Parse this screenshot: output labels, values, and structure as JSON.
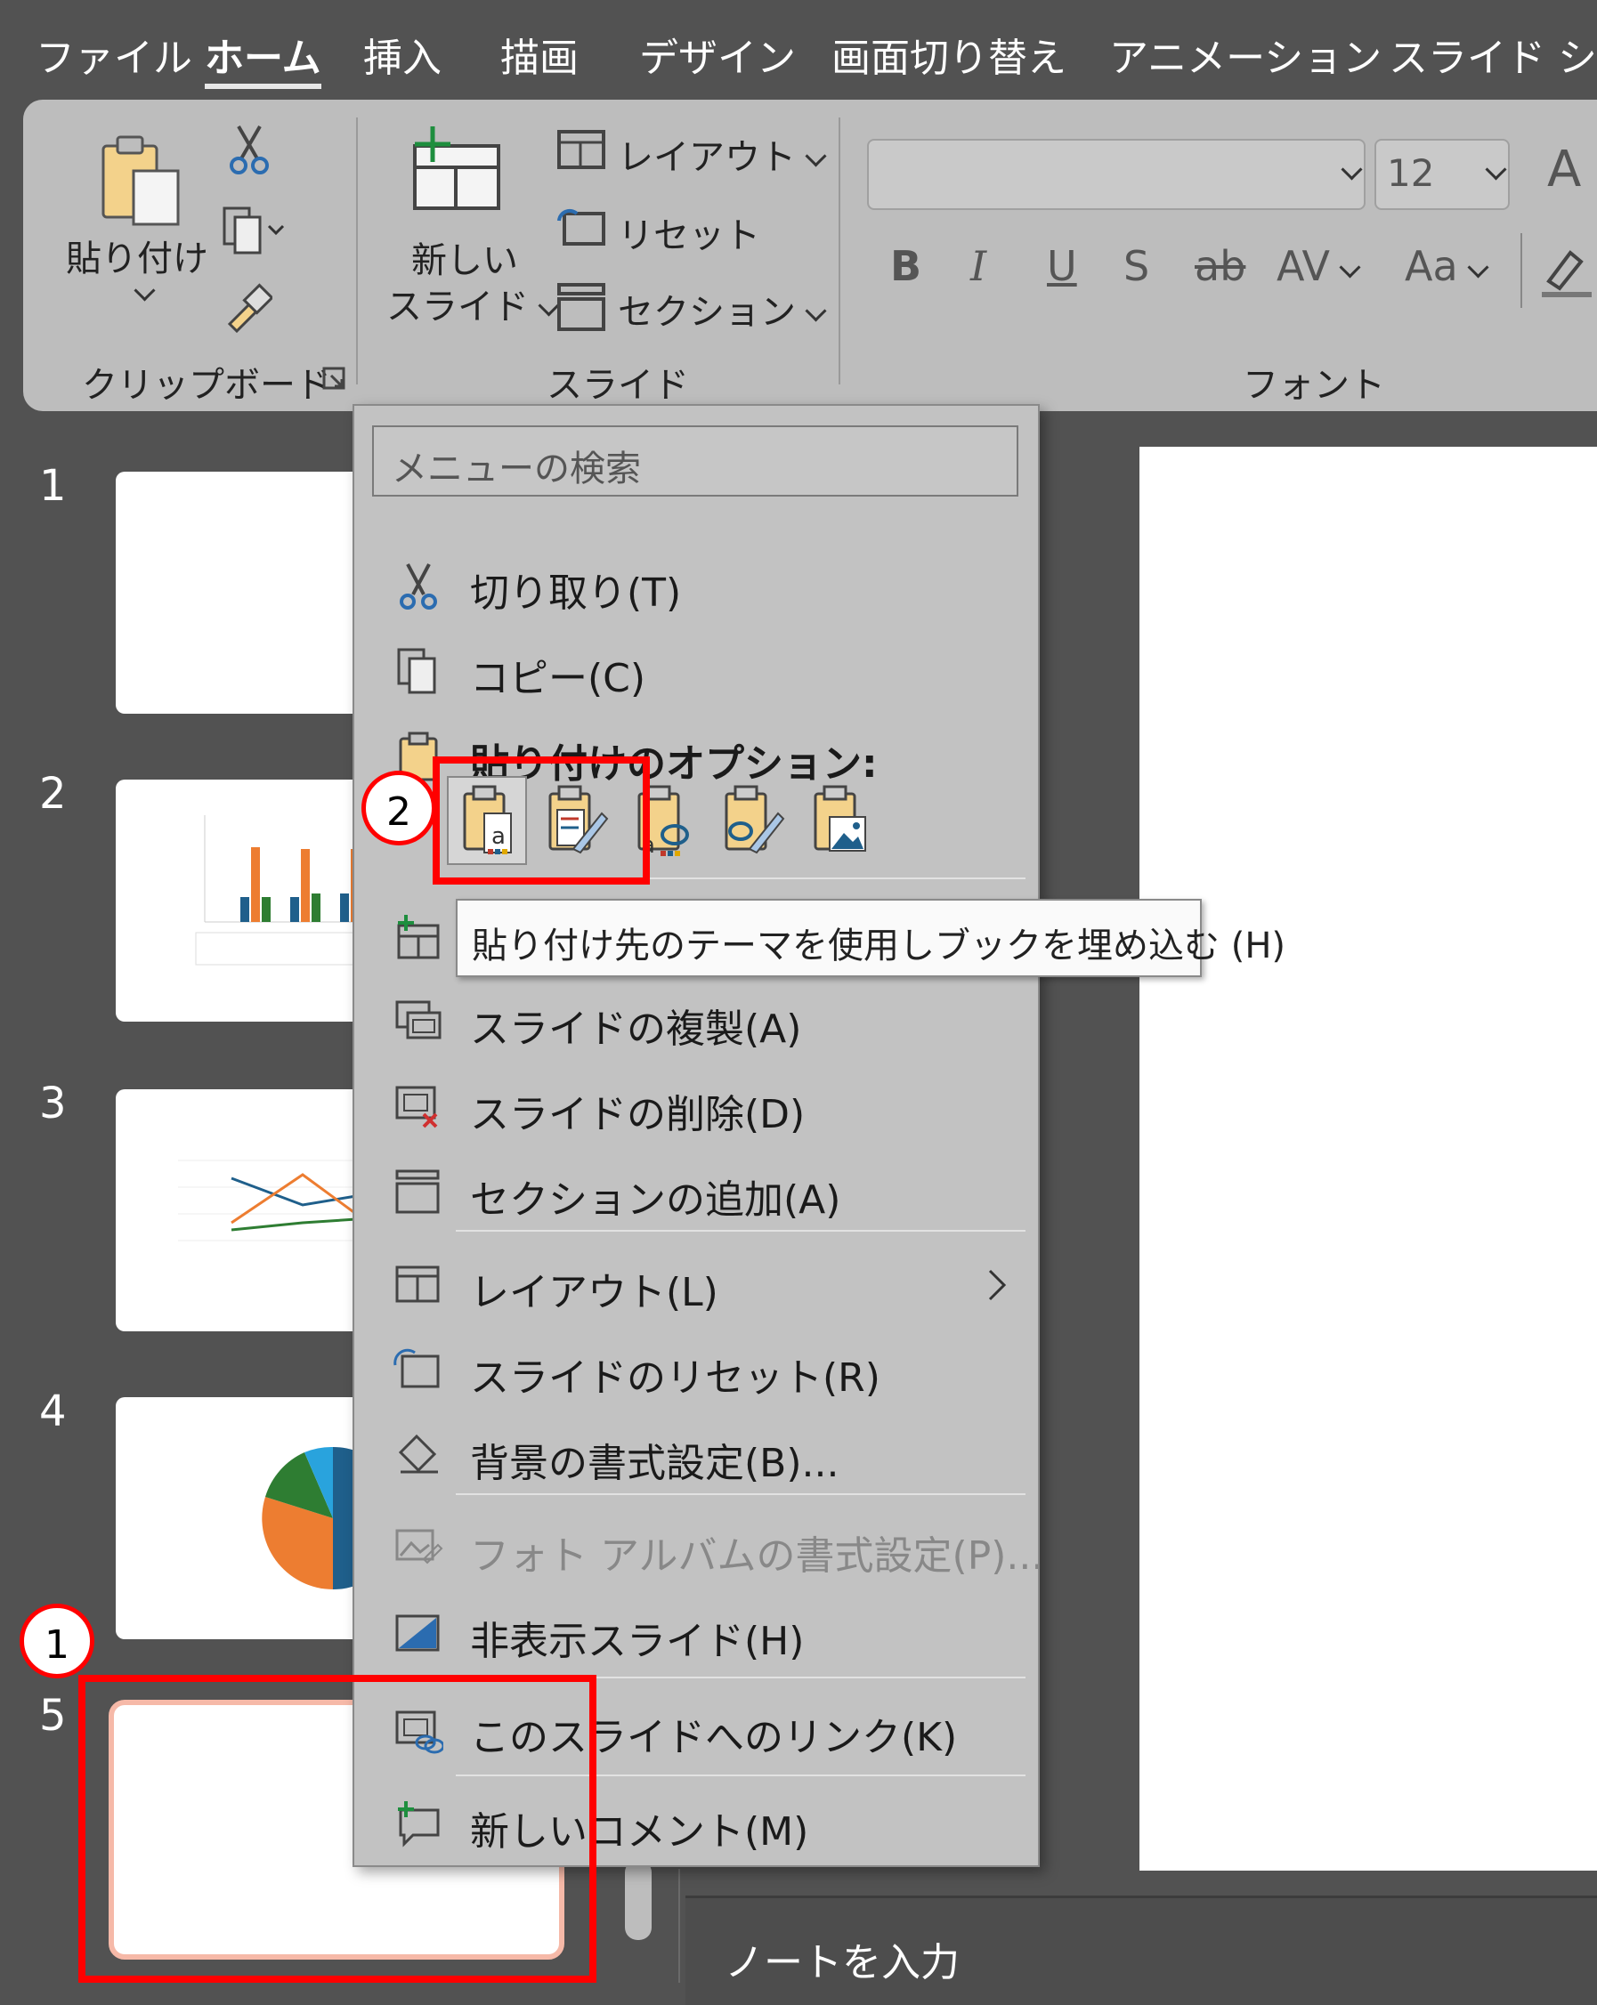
{
  "tabs": [
    "ファイル",
    "ホーム",
    "挿入",
    "描画",
    "デザイン",
    "画面切り替え",
    "アニメーション",
    "スライド ショー"
  ],
  "ribbon": {
    "paste_label": "貼り付け",
    "clipboard_group": "クリップボード",
    "new_slide_label_1": "新しい",
    "new_slide_label_2": "スライド",
    "layout_label": "レイアウト",
    "reset_label": "リセット",
    "section_label": "セクション",
    "slides_group": "スライド",
    "font_size": "12",
    "bold": "B",
    "italic": "I",
    "underline": "U",
    "shadow": "S",
    "strike": "ab",
    "spacing": "AV",
    "change_case": "Aa",
    "grow_font": "A",
    "font_group": "フォント"
  },
  "slide_numbers": [
    "1",
    "2",
    "3",
    "4",
    "5"
  ],
  "notes_placeholder": "ノートを入力",
  "menu": {
    "search_placeholder": "メニューの検索",
    "cut": "切り取り(T)",
    "copy": "コピー(C)",
    "paste_options": "貼り付けのオプション:",
    "duplicate": "スライドの複製(A)",
    "delete": "スライドの削除(D)",
    "add_section": "セクションの追加(A)",
    "layout": "レイアウト(L)",
    "reset": "スライドのリセット(R)",
    "format_bg": "背景の書式設定(B)...",
    "photo_album": "フォト アルバムの書式設定(P)...",
    "hide": "非表示スライド(H)",
    "link": "このスライドへのリンク(K)",
    "comment": "新しいコメント(M)"
  },
  "tooltip": "貼り付け先のテーマを使用しブックを埋め込む (H)",
  "annotations": [
    "1",
    "2"
  ]
}
